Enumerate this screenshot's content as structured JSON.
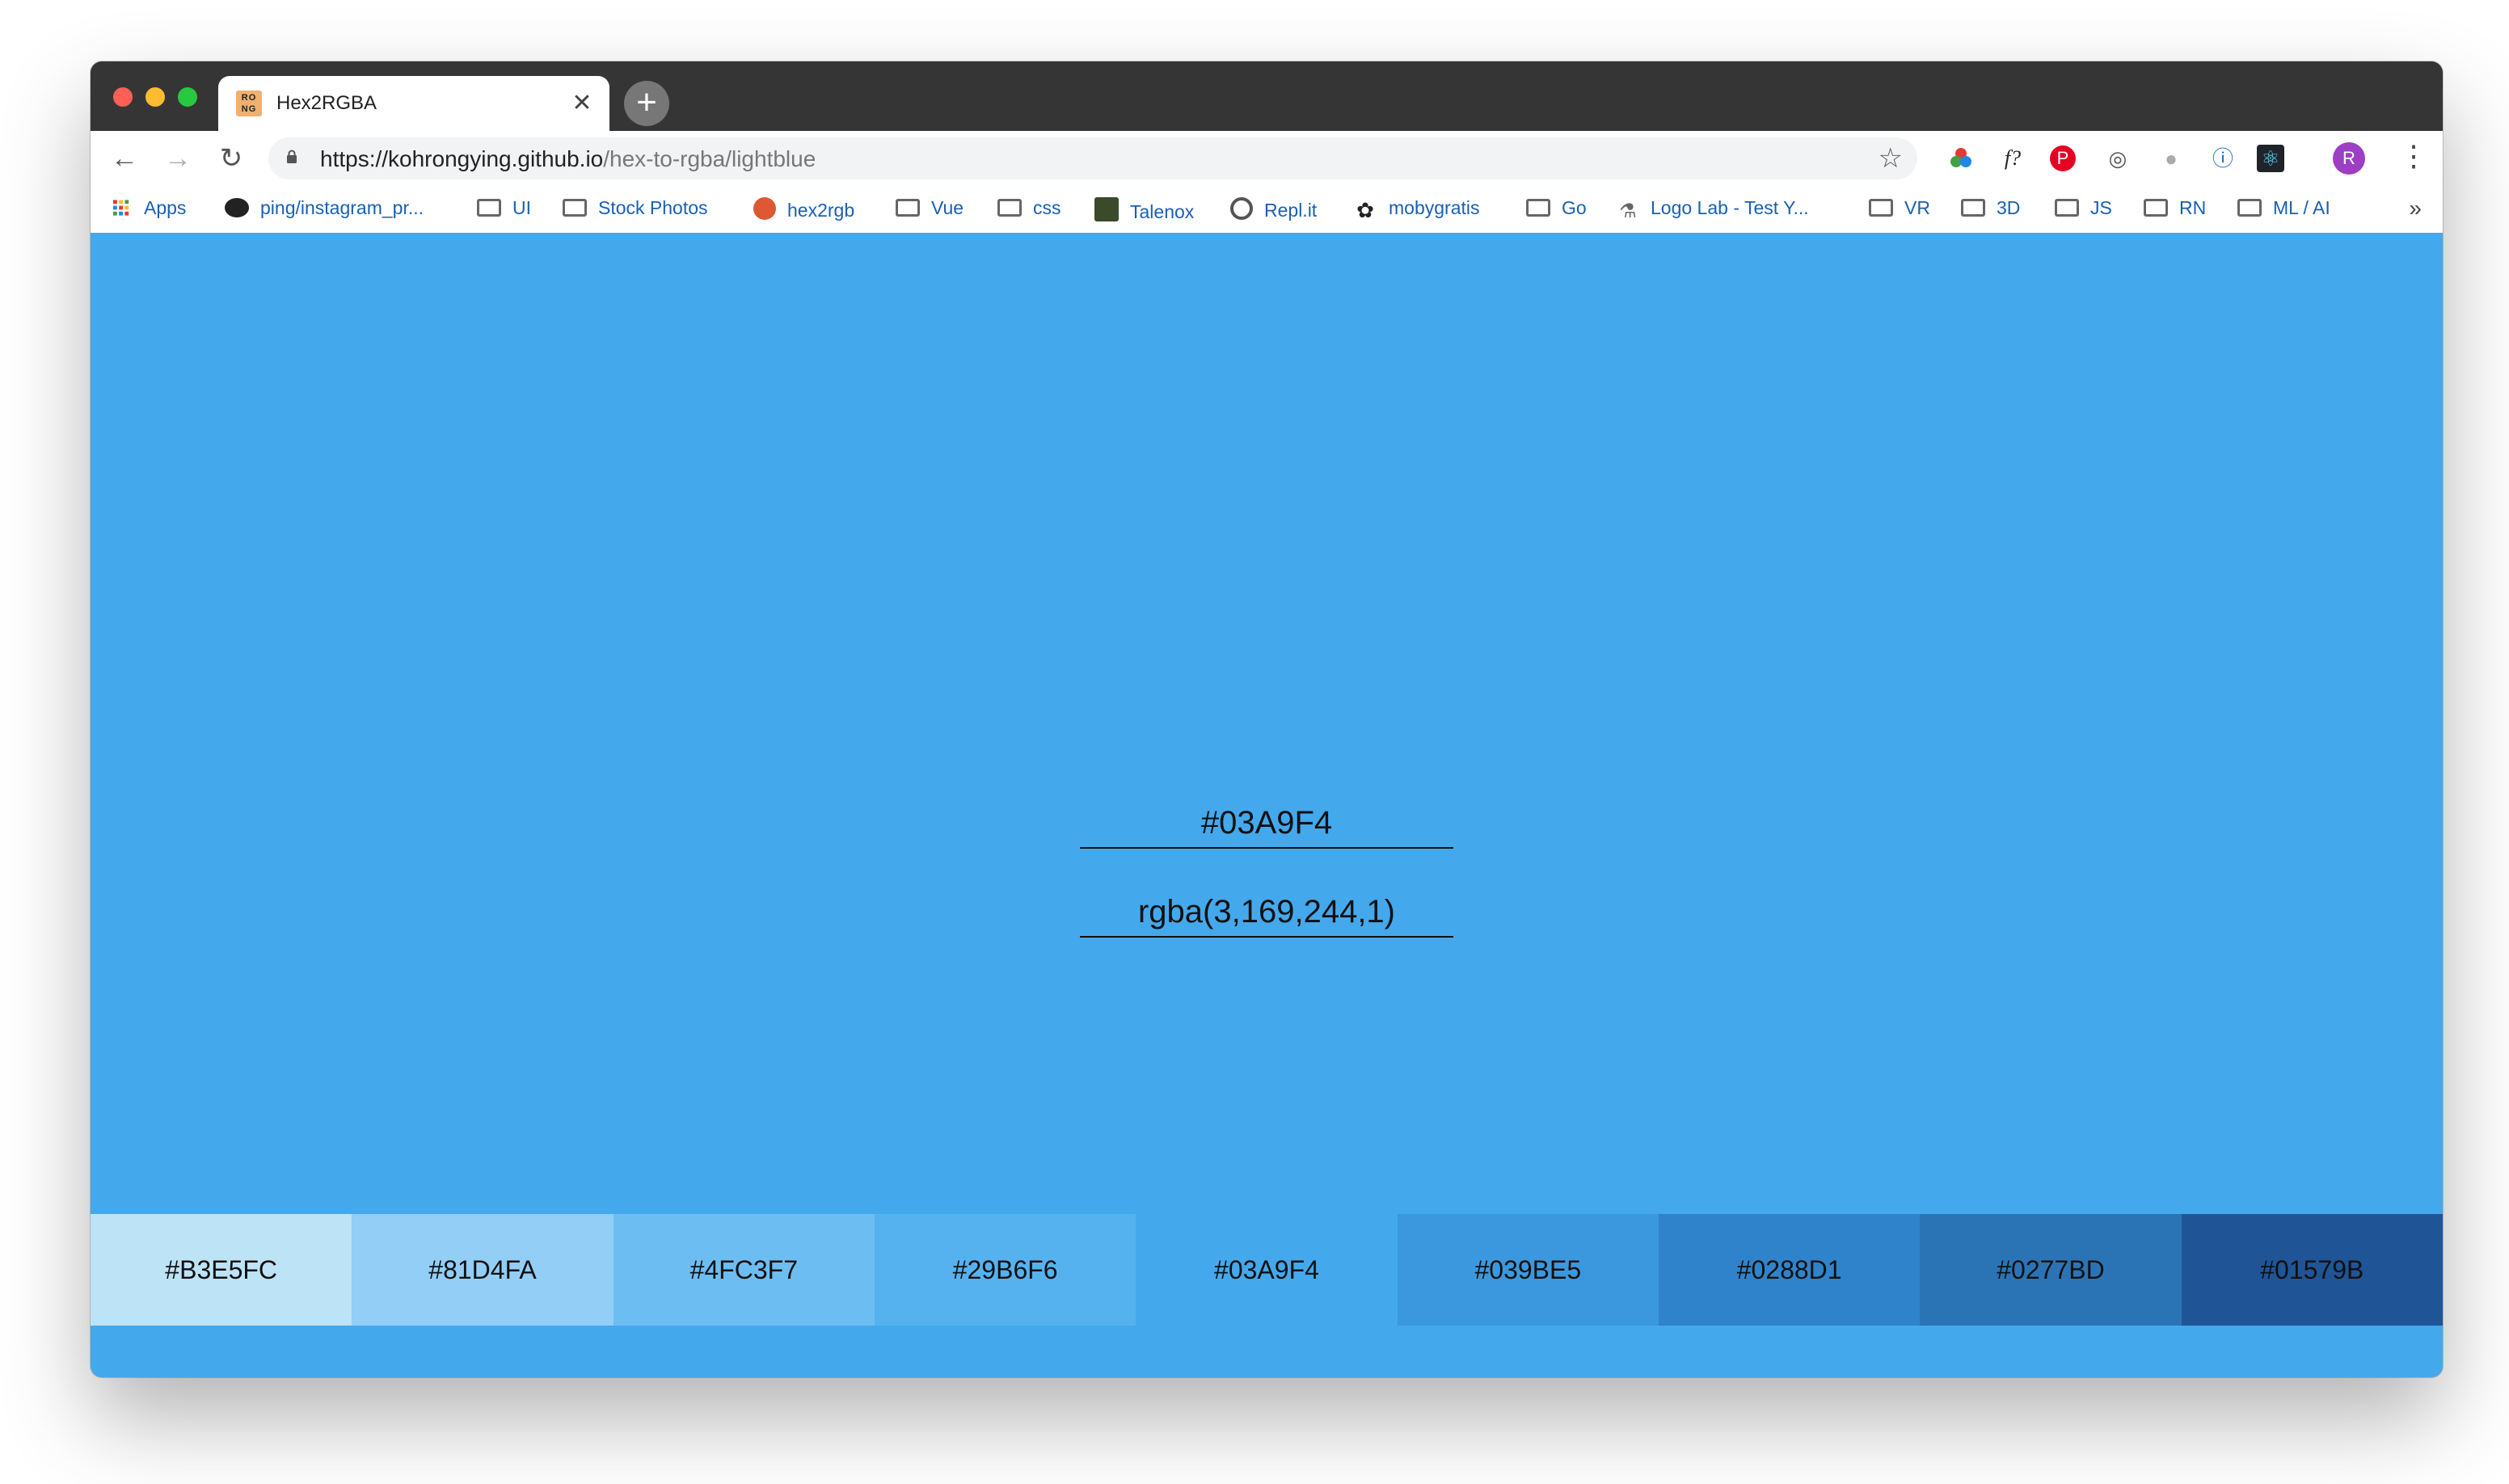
{
  "browser": {
    "tab_title": "Hex2RGBA",
    "tab_favicon_text": "RO NG",
    "url_host": "https://kohrongying.github.io",
    "url_path": "/hex-to-rgba/lightblue",
    "avatar_initial": "R"
  },
  "bookmarks": [
    {
      "label": "Apps",
      "icon": "apps-grid-icon"
    },
    {
      "label": "ping/instagram_pr...",
      "icon": "github-icon"
    },
    {
      "label": "UI",
      "icon": "folder-icon"
    },
    {
      "label": "Stock Photos",
      "icon": "folder-icon"
    },
    {
      "label": "hex2rgb",
      "icon": "duckduckgo-icon"
    },
    {
      "label": "Vue",
      "icon": "folder-icon"
    },
    {
      "label": "css",
      "icon": "folder-icon"
    },
    {
      "label": "Talenox",
      "icon": "talenox-icon"
    },
    {
      "label": "Repl.it",
      "icon": "replit-icon"
    },
    {
      "label": "mobygratis",
      "icon": "mobygratis-icon"
    },
    {
      "label": "Go",
      "icon": "folder-icon"
    },
    {
      "label": "Logo Lab - Test Y...",
      "icon": "logo-lab-icon"
    },
    {
      "label": "VR",
      "icon": "folder-icon"
    },
    {
      "label": "3D",
      "icon": "folder-icon"
    },
    {
      "label": "JS",
      "icon": "folder-icon"
    },
    {
      "label": "RN",
      "icon": "folder-icon"
    },
    {
      "label": "ML / AI",
      "icon": "folder-icon"
    }
  ],
  "converter": {
    "hex_value": "#03A9F4",
    "rgba_value": "rgba(3,169,244,1)",
    "background_color": "#44a8ec"
  },
  "palette": [
    {
      "hex": "#B3E5FC",
      "color": "#bde3f7"
    },
    {
      "hex": "#81D4FA",
      "color": "#92cef6"
    },
    {
      "hex": "#4FC3F7",
      "color": "#6cbdf2"
    },
    {
      "hex": "#29B6F6",
      "color": "#55b2ef"
    },
    {
      "hex": "#03A9F4",
      "color": "#44a8ec"
    },
    {
      "hex": "#039BE5",
      "color": "#3b98de"
    },
    {
      "hex": "#0288D1",
      "color": "#2f83ca"
    },
    {
      "hex": "#0277BD",
      "color": "#2a74b6"
    },
    {
      "hex": "#01579B",
      "color": "#1f5597"
    }
  ]
}
